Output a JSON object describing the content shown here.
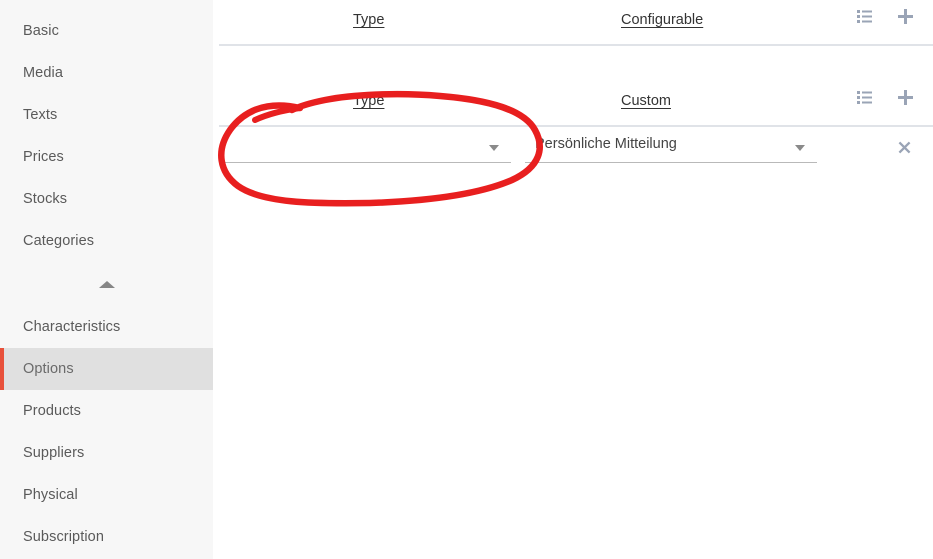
{
  "sidebar": {
    "items": [
      {
        "label": "Basic",
        "active": false
      },
      {
        "label": "Media",
        "active": false
      },
      {
        "label": "Texts",
        "active": false
      },
      {
        "label": "Prices",
        "active": false
      },
      {
        "label": "Stocks",
        "active": false
      },
      {
        "label": "Categories",
        "active": false
      }
    ],
    "collapse_icon": "caret-up-icon",
    "items_after": [
      {
        "label": "Characteristics",
        "active": false
      },
      {
        "label": "Options",
        "active": true
      },
      {
        "label": "Products",
        "active": false
      },
      {
        "label": "Suppliers",
        "active": false
      },
      {
        "label": "Physical",
        "active": false
      },
      {
        "label": "Subscription",
        "active": false
      }
    ],
    "active_accent_color": "#e8513b",
    "active_background_color": "#e0e0e0",
    "background_color": "#f7f7f7"
  },
  "main": {
    "rows": [
      {
        "header_type_label": "Type",
        "header_value_label": "Configurable",
        "list_icon": "list-icon",
        "add_icon": "plus-icon",
        "has_fields": false
      },
      {
        "header_type_label": "Type",
        "header_value_label": "Custom",
        "list_icon": "list-icon",
        "add_icon": "plus-icon",
        "has_fields": true,
        "type_select_value": "",
        "type_select_caret": "caret-down-icon",
        "value_select_value": "Persönliche Mitteilung",
        "value_select_caret": "caret-down-icon",
        "remove_icon": "close-icon"
      }
    ],
    "icon_color": "#9aa4b6",
    "divider_color": "#e0e3e8",
    "field_underline_color": "#b9b9b9"
  },
  "annotation": {
    "type": "hand-drawn-ellipse",
    "color": "#e81f1f",
    "stroke_width": 6,
    "target": "type-select-first-column"
  }
}
